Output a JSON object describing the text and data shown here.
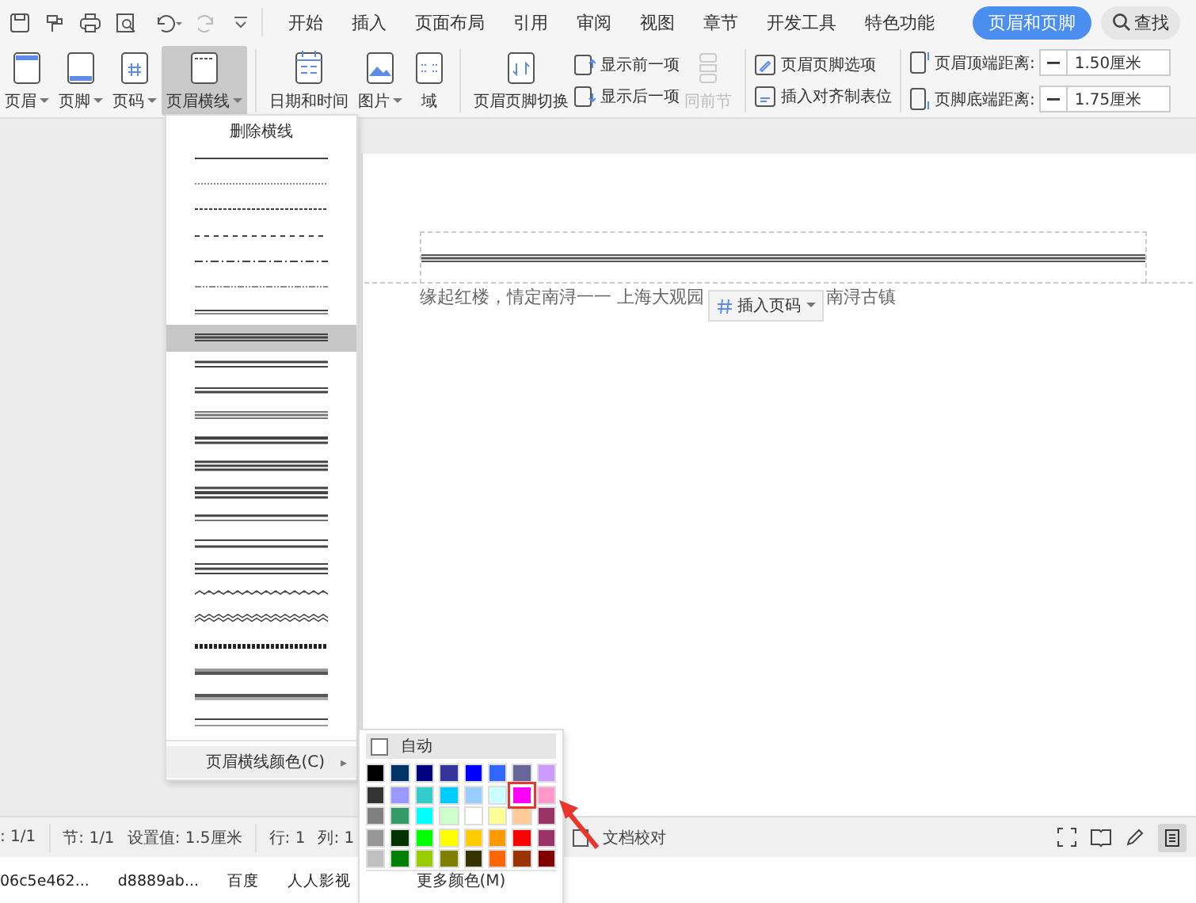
{
  "tabs": [
    {
      "label": "开始",
      "selected": false
    },
    {
      "label": "插入",
      "selected": false
    },
    {
      "label": "页面布局",
      "selected": false
    },
    {
      "label": "引用",
      "selected": false
    },
    {
      "label": "审阅",
      "selected": false
    },
    {
      "label": "视图",
      "selected": false
    },
    {
      "label": "章节",
      "selected": false
    },
    {
      "label": "开发工具",
      "selected": false
    },
    {
      "label": "特色功能",
      "selected": false
    },
    {
      "label": "页眉和页脚",
      "selected": true
    }
  ],
  "search_button": "查找",
  "ribbon": {
    "large_buttons": [
      {
        "label": "页眉",
        "dropdown": true,
        "pressed": false,
        "disabled": false
      },
      {
        "label": "页脚",
        "dropdown": true,
        "pressed": false,
        "disabled": false
      },
      {
        "label": "页码",
        "dropdown": true,
        "pressed": false,
        "disabled": false
      },
      {
        "label": "页眉横线",
        "dropdown": true,
        "pressed": true,
        "disabled": false
      },
      {
        "label": "日期和时间",
        "dropdown": false,
        "pressed": false,
        "disabled": false
      },
      {
        "label": "图片",
        "dropdown": true,
        "pressed": false,
        "disabled": false
      },
      {
        "label": "域",
        "dropdown": false,
        "pressed": false,
        "disabled": false
      },
      {
        "label": "页眉页脚切换",
        "dropdown": false,
        "pressed": false,
        "disabled": false
      }
    ],
    "nav_buttons": [
      "显示前一项",
      "显示后一项"
    ],
    "same_as_previous": {
      "label": "同前节",
      "disabled": true
    },
    "option_buttons": [
      "页眉页脚选项",
      "插入对齐制表位"
    ],
    "distances": [
      {
        "label": "页眉顶端距离:",
        "value": "1.50厘米"
      },
      {
        "label": "页脚底端距离:",
        "value": "1.75厘米"
      }
    ]
  },
  "line_menu": {
    "title": "删除横线",
    "styles": [
      {
        "kind": "solid",
        "selected": false
      },
      {
        "kind": "dotted",
        "selected": false
      },
      {
        "kind": "dense-dashed",
        "selected": false
      },
      {
        "kind": "dashed",
        "selected": false
      },
      {
        "kind": "dash-dot",
        "selected": false
      },
      {
        "kind": "dash-dot-dot",
        "selected": false
      },
      {
        "kind": "double",
        "selected": false
      },
      {
        "kind": "triple",
        "selected": true
      },
      {
        "kind": "thick-thin",
        "selected": false
      },
      {
        "kind": "thin-double",
        "selected": false
      },
      {
        "kind": "grey-triple",
        "selected": false
      },
      {
        "kind": "thick-double",
        "selected": false
      },
      {
        "kind": "thick-triple",
        "selected": false
      },
      {
        "kind": "heavy-triple",
        "selected": false
      },
      {
        "kind": "thin-thick",
        "selected": false
      },
      {
        "kind": "wide-double",
        "selected": false
      },
      {
        "kind": "wide-triple",
        "selected": false
      },
      {
        "kind": "wave",
        "selected": false
      },
      {
        "kind": "double-wave",
        "selected": false
      },
      {
        "kind": "hatched",
        "selected": false
      },
      {
        "kind": "emboss",
        "selected": false
      },
      {
        "kind": "engrave",
        "selected": false
      },
      {
        "kind": "thin-double-wide",
        "selected": false
      }
    ],
    "color_item": {
      "label": "页眉横线颜色(C)",
      "arrow": "▸"
    }
  },
  "color_menu": {
    "auto": {
      "label": "自动",
      "checked": false
    },
    "swatches": [
      {
        "color": "#000000",
        "marked": false
      },
      {
        "color": "#003366",
        "marked": false
      },
      {
        "color": "#000080",
        "marked": false
      },
      {
        "color": "#333399",
        "marked": false
      },
      {
        "color": "#0000ff",
        "marked": false
      },
      {
        "color": "#3366ff",
        "marked": false
      },
      {
        "color": "#666699",
        "marked": false
      },
      {
        "color": "#cc99ff",
        "marked": false
      },
      {
        "color": "#333333",
        "marked": false
      },
      {
        "color": "#9999ff",
        "marked": false
      },
      {
        "color": "#33cccc",
        "marked": false
      },
      {
        "color": "#00ccff",
        "marked": false
      },
      {
        "color": "#99ccff",
        "marked": false
      },
      {
        "color": "#ccffff",
        "marked": false
      },
      {
        "color": "#ff00ff",
        "marked": true
      },
      {
        "color": "#ff99cc",
        "marked": false
      },
      {
        "color": "#808080",
        "marked": false
      },
      {
        "color": "#339966",
        "marked": false
      },
      {
        "color": "#00ffff",
        "marked": false
      },
      {
        "color": "#ccffcc",
        "marked": false
      },
      {
        "color": "#ffffff",
        "marked": false
      },
      {
        "color": "#ffff99",
        "marked": false
      },
      {
        "color": "#ffcc99",
        "marked": false
      },
      {
        "color": "#993366",
        "marked": false
      },
      {
        "color": "#969696",
        "marked": false
      },
      {
        "color": "#003300",
        "marked": false
      },
      {
        "color": "#00ff00",
        "marked": false
      },
      {
        "color": "#ffff00",
        "marked": false
      },
      {
        "color": "#ffcc00",
        "marked": false
      },
      {
        "color": "#ff9900",
        "marked": false
      },
      {
        "color": "#ff0000",
        "marked": false
      },
      {
        "color": "#993366",
        "marked": false
      },
      {
        "color": "#c0c0c0",
        "marked": false
      },
      {
        "color": "#008000",
        "marked": false
      },
      {
        "color": "#99cc00",
        "marked": false
      },
      {
        "color": "#808000",
        "marked": false
      },
      {
        "color": "#333300",
        "marked": false
      },
      {
        "color": "#ff6600",
        "marked": false
      },
      {
        "color": "#993300",
        "marked": false
      },
      {
        "color": "#800000",
        "marked": false
      }
    ],
    "more": "更多颜色(M)"
  },
  "document": {
    "body_before": "缘起红楼，情定南浔一一  上海大观园",
    "insert_page_number": "插入页码",
    "body_after": "南浔古镇"
  },
  "status_bar": {
    "items": [
      ": 1/1",
      "节: 1/1",
      "设置值: 1.5厘米",
      "行: 1",
      "列: 1"
    ],
    "proofread": "文档校对"
  },
  "taskbar": [
    "06c5e462...",
    "d8889ab...",
    "百度",
    "人人影视"
  ]
}
